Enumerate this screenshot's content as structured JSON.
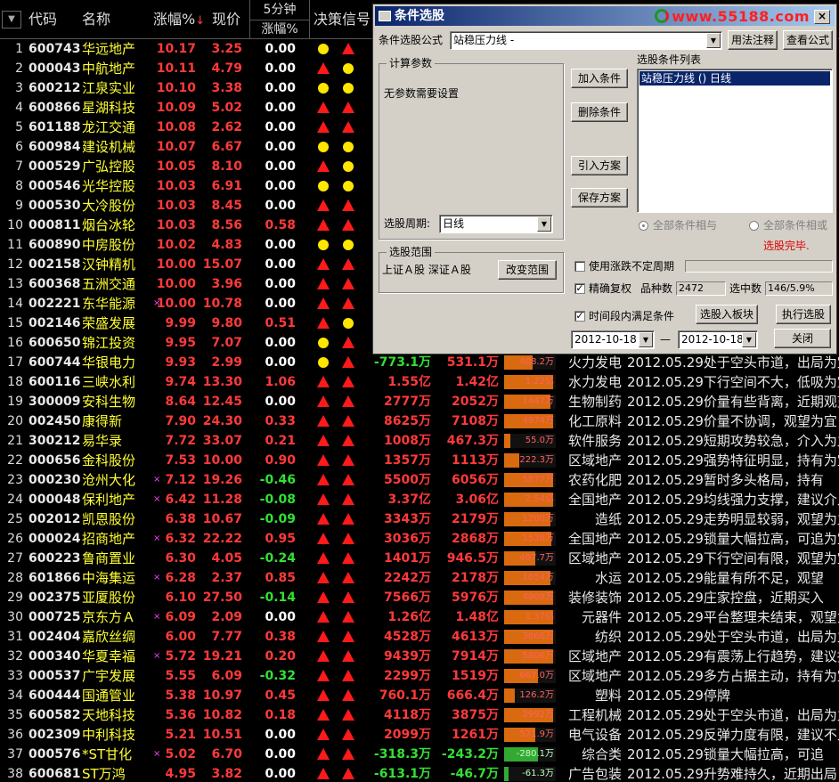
{
  "header": {
    "sort_indicator": "▼",
    "code": "代码",
    "name": "名称",
    "change_pct": "涨幅%",
    "sort_arrow": "↓",
    "price": "现价",
    "five_min_top": "5分钟",
    "five_min_bottom": "涨幅%",
    "signal": "决策信号"
  },
  "signal_colors": {
    "dot": "#ffe600",
    "tri": "#ff1a1a"
  },
  "rows": [
    {
      "no": "1",
      "code": "600743",
      "name": "华远地产",
      "mark": "",
      "pct": "10.17",
      "price": "3.25",
      "m5": "0.00",
      "m5c": "",
      "s1": "dot",
      "s2": "tri"
    },
    {
      "no": "2",
      "code": "000043",
      "name": "中航地产",
      "mark": "",
      "pct": "10.11",
      "price": "4.79",
      "m5": "0.00",
      "m5c": "",
      "s1": "tri",
      "s2": "dot"
    },
    {
      "no": "3",
      "code": "600212",
      "name": "江泉实业",
      "mark": "",
      "pct": "10.10",
      "price": "3.38",
      "m5": "0.00",
      "m5c": "",
      "s1": "dot",
      "s2": "dot"
    },
    {
      "no": "4",
      "code": "600866",
      "name": "星湖科技",
      "mark": "",
      "pct": "10.09",
      "price": "5.02",
      "m5": "0.00",
      "m5c": "",
      "s1": "tri",
      "s2": "tri"
    },
    {
      "no": "5",
      "code": "601188",
      "name": "龙江交通",
      "mark": "",
      "pct": "10.08",
      "price": "2.62",
      "m5": "0.00",
      "m5c": "",
      "s1": "tri",
      "s2": "tri"
    },
    {
      "no": "6",
      "code": "600984",
      "name": "建设机械",
      "mark": "",
      "pct": "10.07",
      "price": "6.67",
      "m5": "0.00",
      "m5c": "",
      "s1": "dot",
      "s2": "dot"
    },
    {
      "no": "7",
      "code": "000529",
      "name": "广弘控股",
      "mark": "",
      "pct": "10.05",
      "price": "8.10",
      "m5": "0.00",
      "m5c": "",
      "s1": "tri",
      "s2": "dot"
    },
    {
      "no": "8",
      "code": "000546",
      "name": "光华控股",
      "mark": "",
      "pct": "10.03",
      "price": "6.91",
      "m5": "0.00",
      "m5c": "",
      "s1": "dot",
      "s2": "dot"
    },
    {
      "no": "9",
      "code": "000530",
      "name": "大冷股份",
      "mark": "",
      "pct": "10.03",
      "price": "8.45",
      "m5": "0.00",
      "m5c": "",
      "s1": "tri",
      "s2": "tri"
    },
    {
      "no": "10",
      "code": "000811",
      "name": "烟台冰轮",
      "mark": "",
      "pct": "10.03",
      "price": "8.56",
      "m5": "0.58",
      "m5c": "up",
      "s1": "tri",
      "s2": "tri"
    },
    {
      "no": "11",
      "code": "600890",
      "name": "中房股份",
      "mark": "",
      "pct": "10.02",
      "price": "4.83",
      "m5": "0.00",
      "m5c": "",
      "s1": "dot",
      "s2": "dot"
    },
    {
      "no": "12",
      "code": "002158",
      "name": "汉钟精机",
      "mark": "",
      "pct": "10.00",
      "price": "15.07",
      "m5": "0.00",
      "m5c": "",
      "s1": "tri",
      "s2": "tri"
    },
    {
      "no": "13",
      "code": "600368",
      "name": "五洲交通",
      "mark": "",
      "pct": "10.00",
      "price": "3.96",
      "m5": "0.00",
      "m5c": "",
      "s1": "tri",
      "s2": "tri"
    },
    {
      "no": "14",
      "code": "002221",
      "name": "东华能源",
      "mark": "×",
      "pct": "10.00",
      "price": "10.78",
      "m5": "0.00",
      "m5c": "",
      "s1": "tri",
      "s2": "tri"
    },
    {
      "no": "15",
      "code": "002146",
      "name": "荣盛发展",
      "mark": "",
      "pct": "9.99",
      "price": "9.80",
      "m5": "0.51",
      "m5c": "up",
      "s1": "tri",
      "s2": "dot"
    },
    {
      "no": "16",
      "code": "600650",
      "name": "锦江投资",
      "mark": "",
      "pct": "9.95",
      "price": "7.07",
      "m5": "0.00",
      "m5c": "",
      "s1": "dot",
      "s2": "tri"
    },
    {
      "no": "17",
      "code": "600744",
      "name": "华银电力",
      "mark": "",
      "pct": "9.93",
      "price": "2.99",
      "m5": "0.00",
      "m5c": "",
      "s1": "dot",
      "s2": "tri",
      "net": "-773.1万",
      "netc": "dn",
      "amt": "531.1万",
      "amtc": "up",
      "bar": "408.2万",
      "barf": 0.55,
      "barneg": false,
      "ind": "火力发电",
      "cmt": "2012.05.29处于空头市道，出局为宜"
    },
    {
      "no": "18",
      "code": "600116",
      "name": "三峡水利",
      "mark": "",
      "pct": "9.74",
      "price": "13.30",
      "m5": "1.06",
      "m5c": "up",
      "s1": "tri",
      "s2": "tri",
      "net": "1.55亿",
      "netc": "up",
      "amt": "1.42亿",
      "amtc": "up",
      "bar": "1.22亿",
      "barf": 0.95,
      "barneg": false,
      "ind": "水力发电",
      "cmt": "2012.05.29下行空间不大，低吸为宜"
    },
    {
      "no": "19",
      "code": "300009",
      "name": "安科生物",
      "mark": "",
      "pct": "8.64",
      "price": "12.45",
      "m5": "0.00",
      "m5c": "",
      "s1": "tri",
      "s2": "tri",
      "net": "2777万",
      "netc": "up",
      "amt": "2052万",
      "amtc": "up",
      "bar": "1447万",
      "barf": 0.9,
      "barneg": false,
      "ind": "生物制药",
      "cmt": "2012.05.29价量有些背离，近期观望"
    },
    {
      "no": "20",
      "code": "002450",
      "name": "康得新",
      "mark": "",
      "pct": "7.90",
      "price": "24.30",
      "m5": "0.33",
      "m5c": "up",
      "s1": "tri",
      "s2": "tri",
      "net": "8625万",
      "netc": "up",
      "amt": "7108万",
      "amtc": "up",
      "bar": "4974万",
      "barf": 0.95,
      "barneg": false,
      "ind": "化工原料",
      "cmt": "2012.05.29价量不协调，观望为宜"
    },
    {
      "no": "21",
      "code": "300212",
      "name": "易华录",
      "mark": "",
      "pct": "7.72",
      "price": "33.07",
      "m5": "0.21",
      "m5c": "up",
      "s1": "tri",
      "s2": "tri",
      "net": "1008万",
      "netc": "up",
      "amt": "467.3万",
      "amtc": "up",
      "bar": "55.0万",
      "barf": 0.12,
      "barneg": false,
      "ind": "软件服务",
      "cmt": "2012.05.29短期攻势较急，介入为主"
    },
    {
      "no": "22",
      "code": "000656",
      "name": "金科股份",
      "mark": "",
      "pct": "7.53",
      "price": "10.00",
      "m5": "0.90",
      "m5c": "up",
      "s1": "tri",
      "s2": "tri",
      "net": "1357万",
      "netc": "up",
      "amt": "1113万",
      "amtc": "up",
      "bar": "222.3万",
      "barf": 0.3,
      "barneg": false,
      "ind": "区域地产",
      "cmt": "2012.05.29强势特征明显，持有为宜"
    },
    {
      "no": "23",
      "code": "000230",
      "name": "沧州大化",
      "mark": "×",
      "pct": "7.12",
      "price": "19.26",
      "m5": "-0.46",
      "m5c": "dn",
      "s1": "tri",
      "s2": "tri",
      "net": "5500万",
      "netc": "up",
      "amt": "6056万",
      "amtc": "up",
      "bar": "5877万",
      "barf": 0.95,
      "barneg": false,
      "ind": "农药化肥",
      "cmt": "2012.05.29暂时多头格局，持有"
    },
    {
      "no": "24",
      "code": "000048",
      "name": "保利地产",
      "mark": "×",
      "pct": "6.42",
      "price": "11.28",
      "m5": "-0.08",
      "m5c": "dn",
      "s1": "tri",
      "s2": "tri",
      "net": "3.37亿",
      "netc": "up",
      "amt": "3.06亿",
      "amtc": "up",
      "bar": "2.54亿",
      "barf": 0.95,
      "barneg": false,
      "ind": "全国地产",
      "cmt": "2012.05.29均线强力支撑，建议介入"
    },
    {
      "no": "25",
      "code": "002012",
      "name": "凯恩股份",
      "mark": "",
      "pct": "6.38",
      "price": "10.67",
      "m5": "-0.09",
      "m5c": "dn",
      "s1": "tri",
      "s2": "tri",
      "net": "3343万",
      "netc": "up",
      "amt": "2179万",
      "amtc": "up",
      "bar": "1200万",
      "barf": 0.9,
      "barneg": false,
      "ind": "造纸",
      "cmt": "2012.05.29走势明显较弱，观望为主"
    },
    {
      "no": "26",
      "code": "000024",
      "name": "招商地产",
      "mark": "×",
      "pct": "6.32",
      "price": "22.22",
      "m5": "0.95",
      "m5c": "up",
      "s1": "tri",
      "s2": "tri",
      "net": "3036万",
      "netc": "up",
      "amt": "2868万",
      "amtc": "up",
      "bar": "1538万",
      "barf": 0.92,
      "barneg": false,
      "ind": "全国地产",
      "cmt": "2012.05.29锁量大幅拉高，可追为宜"
    },
    {
      "no": "27",
      "code": "600223",
      "name": "鲁商置业",
      "mark": "",
      "pct": "6.30",
      "price": "4.05",
      "m5": "-0.24",
      "m5c": "dn",
      "s1": "tri",
      "s2": "tri",
      "net": "1401万",
      "netc": "up",
      "amt": "946.5万",
      "amtc": "up",
      "bar": "497.7万",
      "barf": 0.6,
      "barneg": false,
      "ind": "区域地产",
      "cmt": "2012.05.29下行空间有限，观望为宜"
    },
    {
      "no": "28",
      "code": "601866",
      "name": "中海集运",
      "mark": "×",
      "pct": "6.28",
      "price": "2.37",
      "m5": "0.85",
      "m5c": "up",
      "s1": "tri",
      "s2": "tri",
      "net": "2242万",
      "netc": "up",
      "amt": "2178万",
      "amtc": "up",
      "bar": "1054万",
      "barf": 0.9,
      "barneg": false,
      "ind": "水运",
      "cmt": "2012.05.29能量有所不足，观望"
    },
    {
      "no": "29",
      "code": "002375",
      "name": "亚厦股份",
      "mark": "",
      "pct": "6.10",
      "price": "27.50",
      "m5": "-0.14",
      "m5c": "dn",
      "s1": "tri",
      "s2": "tri",
      "net": "7566万",
      "netc": "up",
      "amt": "5976万",
      "amtc": "up",
      "bar": "4909万",
      "barf": 0.95,
      "barneg": false,
      "ind": "装修装饰",
      "cmt": "2012.05.29庄家控盘，近期买入"
    },
    {
      "no": "30",
      "code": "000725",
      "name": "京东方Ａ",
      "mark": "×",
      "pct": "6.09",
      "price": "2.09",
      "m5": "0.00",
      "m5c": "",
      "s1": "tri",
      "s2": "tri",
      "net": "1.26亿",
      "netc": "up",
      "amt": "1.48亿",
      "amtc": "up",
      "bar": "1.37亿",
      "barf": 0.95,
      "barneg": false,
      "ind": "元器件",
      "cmt": "2012.05.29平台整理未结束，观望为宜"
    },
    {
      "no": "31",
      "code": "002404",
      "name": "嘉欣丝绸",
      "mark": "",
      "pct": "6.00",
      "price": "7.77",
      "m5": "0.38",
      "m5c": "up",
      "s1": "tri",
      "s2": "tri",
      "net": "4528万",
      "netc": "up",
      "amt": "4613万",
      "amtc": "up",
      "bar": "3866万",
      "barf": 0.95,
      "barneg": false,
      "ind": "纺织",
      "cmt": "2012.05.29处于空头市道，出局为主"
    },
    {
      "no": "32",
      "code": "000340",
      "name": "华夏幸福",
      "mark": "×",
      "pct": "5.72",
      "price": "19.21",
      "m5": "0.20",
      "m5c": "up",
      "s1": "tri",
      "s2": "tri",
      "net": "9439万",
      "netc": "up",
      "amt": "7914万",
      "amtc": "up",
      "bar": "5806万",
      "barf": 0.95,
      "barneg": false,
      "ind": "区域地产",
      "cmt": "2012.05.29有震荡上行趋势，建议持有"
    },
    {
      "no": "33",
      "code": "000537",
      "name": "广宇发展",
      "mark": "",
      "pct": "5.55",
      "price": "6.09",
      "m5": "-0.32",
      "m5c": "dn",
      "s1": "tri",
      "s2": "tri",
      "net": "2299万",
      "netc": "up",
      "amt": "1519万",
      "amtc": "up",
      "bar": "667.0万",
      "barf": 0.65,
      "barneg": false,
      "ind": "区域地产",
      "cmt": "2012.05.29多方占据主动，持有为宜"
    },
    {
      "no": "34",
      "code": "600444",
      "name": "国通管业",
      "mark": "",
      "pct": "5.38",
      "price": "10.97",
      "m5": "0.45",
      "m5c": "up",
      "s1": "tri",
      "s2": "tri",
      "net": "760.1万",
      "netc": "up",
      "amt": "666.4万",
      "amtc": "up",
      "bar": "126.2万",
      "barf": 0.2,
      "barneg": false,
      "ind": "塑料",
      "cmt": "2012.05.29停牌"
    },
    {
      "no": "35",
      "code": "600582",
      "name": "天地科技",
      "mark": "",
      "pct": "5.36",
      "price": "10.82",
      "m5": "0.18",
      "m5c": "up",
      "s1": "tri",
      "s2": "tri",
      "net": "4118万",
      "netc": "up",
      "amt": "3875万",
      "amtc": "up",
      "bar": "2992万",
      "barf": 0.95,
      "barneg": false,
      "ind": "工程机械",
      "cmt": "2012.05.29处于空头市道，出局为主"
    },
    {
      "no": "36",
      "code": "002309",
      "name": "中利科技",
      "mark": "",
      "pct": "5.21",
      "price": "10.51",
      "m5": "0.00",
      "m5c": "",
      "s1": "tri",
      "s2": "tri",
      "net": "2099万",
      "netc": "up",
      "amt": "1261万",
      "amtc": "up",
      "bar": "571.9万",
      "barf": 0.6,
      "barneg": false,
      "ind": "电气设备",
      "cmt": "2012.05.29反弹力度有限，建议不入"
    },
    {
      "no": "37",
      "code": "000576",
      "name": "*ST甘化",
      "mark": "×",
      "pct": "5.02",
      "price": "6.70",
      "m5": "0.00",
      "m5c": "",
      "s1": "tri",
      "s2": "tri",
      "net": "-318.3万",
      "netc": "dn",
      "amt": "-243.2万",
      "amtc": "dn",
      "bar": "-280.1万",
      "barf": 0.65,
      "barneg": true,
      "ind": "综合类",
      "cmt": "2012.05.29锁量大幅拉高，可追"
    },
    {
      "no": "38",
      "code": "600681",
      "name": "ST万鸿",
      "mark": "",
      "pct": "4.95",
      "price": "3.82",
      "m5": "0.00",
      "m5c": "",
      "s1": "tri",
      "s2": "tri",
      "net": "-613.1万",
      "netc": "dn",
      "amt": "-46.7万",
      "amtc": "dn",
      "bar": "-61.3万",
      "barf": 0.08,
      "barneg": true,
      "ind": "广告包装",
      "cmt": "2012.05.29升势难持久，近期出局"
    }
  ],
  "dialog": {
    "title": "条件选股",
    "logo": "www.55188.com",
    "close": "×",
    "formula_label": "条件选股公式",
    "formula_value": "站稳压力线 -",
    "btn_usage": "用法注释",
    "btn_view": "查看公式",
    "params_group": "计算参数",
    "params_text": "无参数需要设置",
    "btn_add": "加入条件",
    "btn_delete": "删除条件",
    "btn_import": "引入方案",
    "btn_save": "保存方案",
    "cond_list_label": "选股条件列表",
    "cond_item": "站稳压力线 () 日线",
    "period_label": "选股周期:",
    "period_value": "日线",
    "radio_and": "全部条件相与",
    "radio_or": "全部条件相或",
    "status": "选股完毕.",
    "range_group": "选股范围",
    "range_text": "上证Ａ股 深证Ａ股",
    "btn_range": "改变范围",
    "chk_uncertain": "使用涨跌不定周期",
    "chk_rights": "精确复权",
    "chk_rights_mark": "✓",
    "varieties_label": "品种数",
    "varieties_value": "2472",
    "selected_label": "选中数",
    "selected_value": "146/5.9%",
    "chk_time": "时间段内满足条件",
    "chk_time_mark": "✓",
    "btn_to_board": "选股入板块",
    "btn_execute": "执行选股",
    "date_from": "2012-10-18",
    "date_sep": "—",
    "date_to": "2012-10-18",
    "btn_close": "关闭"
  }
}
